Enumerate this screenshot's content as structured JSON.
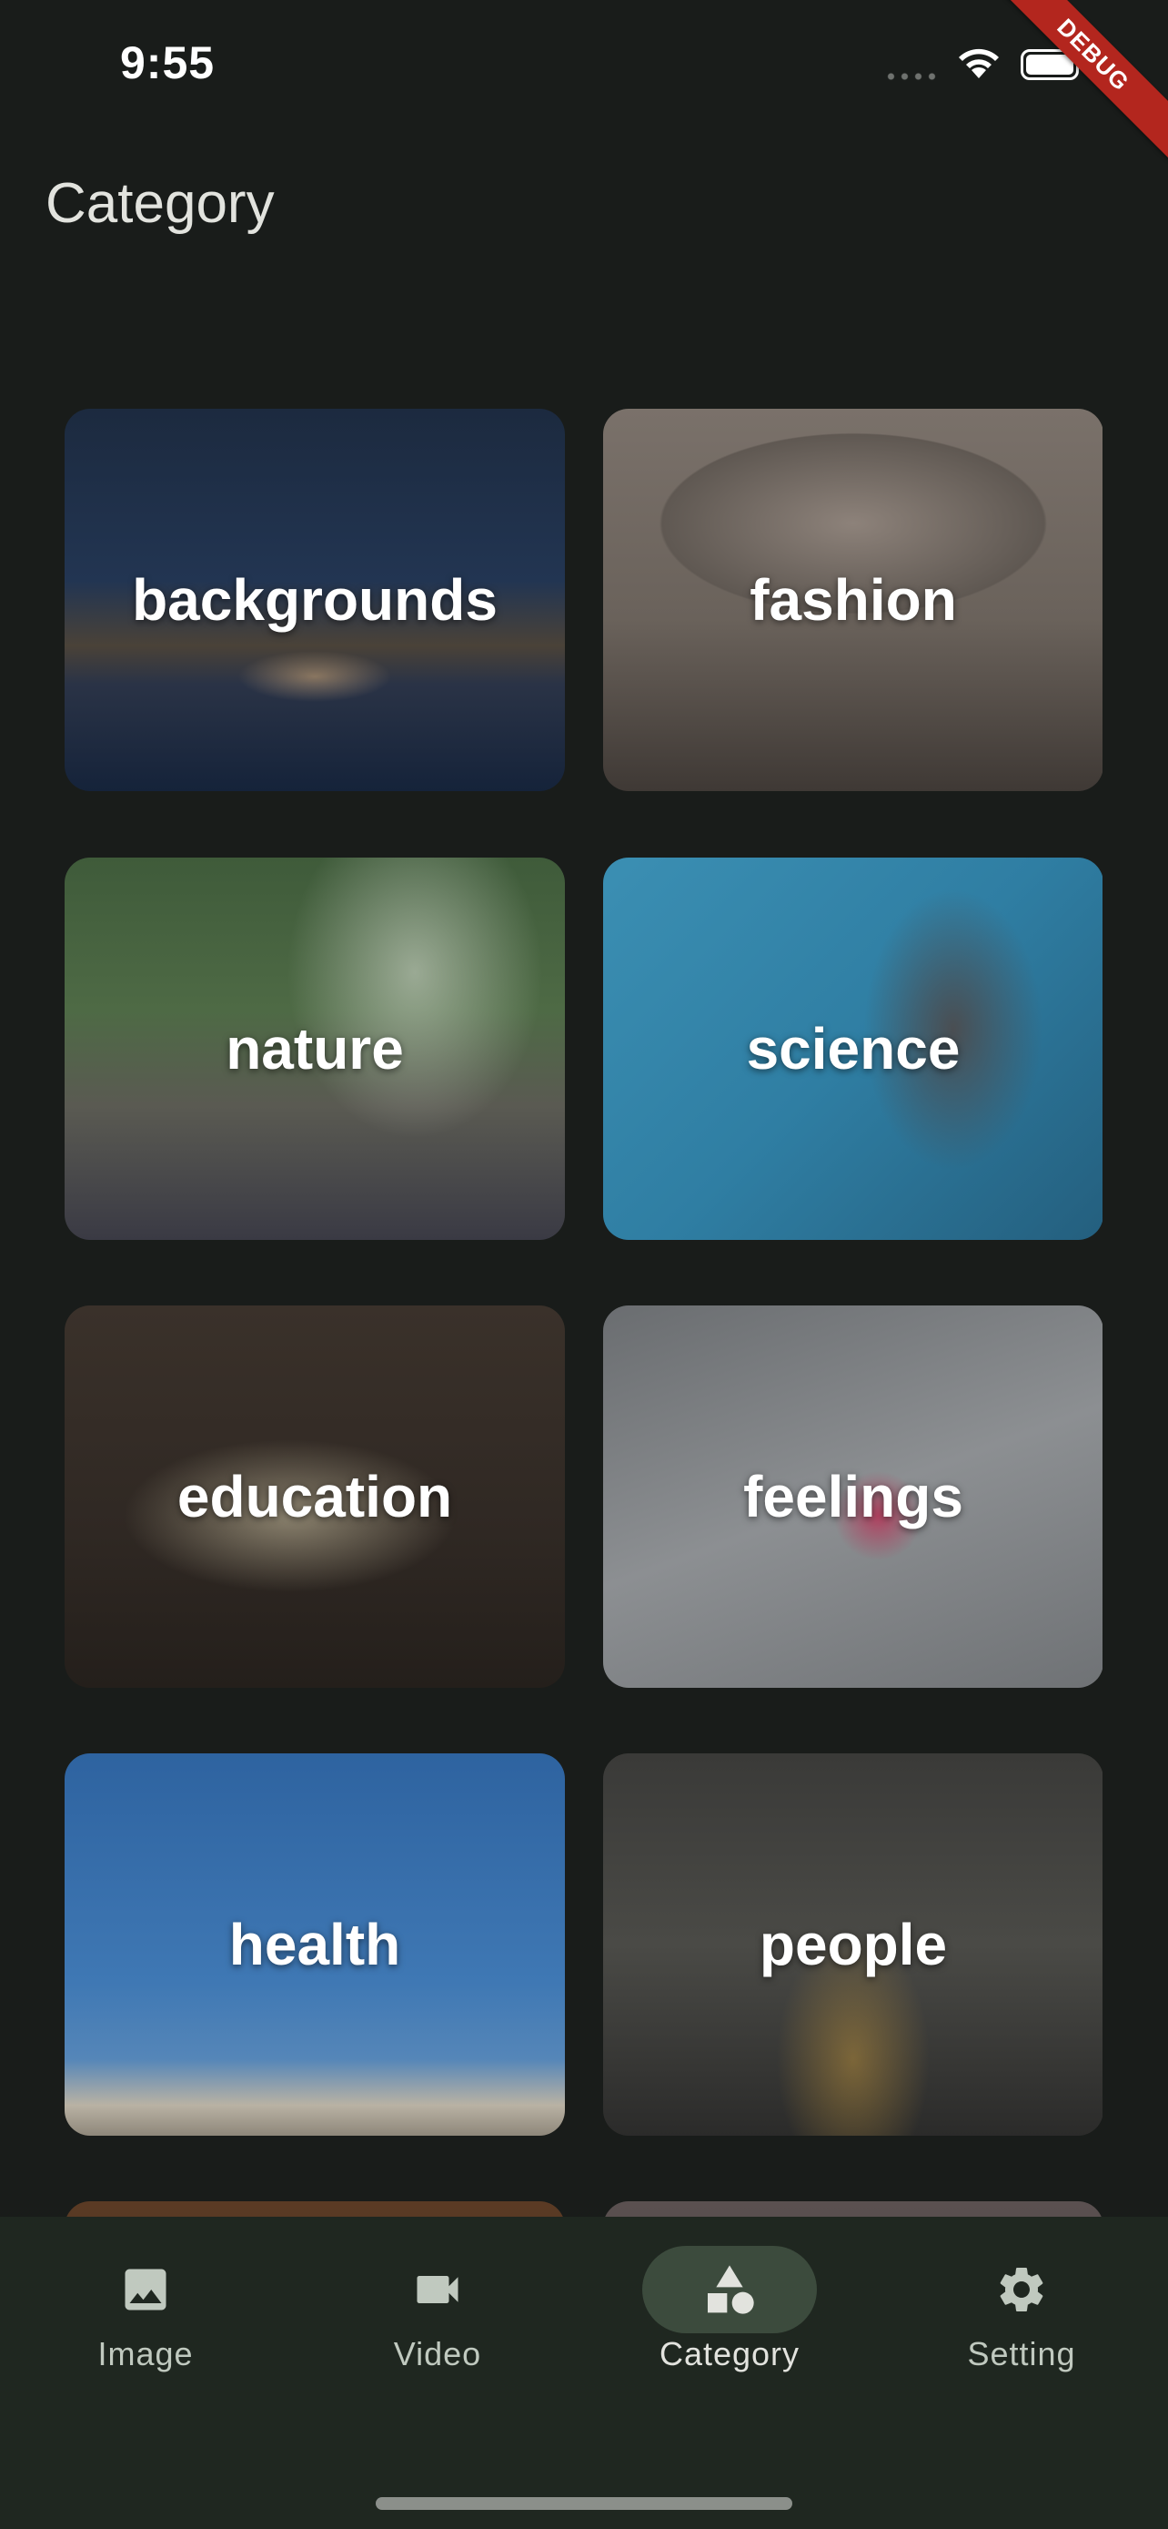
{
  "status_bar": {
    "time": "9:55"
  },
  "debug_banner": "DEBUG",
  "page": {
    "title": "Category"
  },
  "categories": [
    {
      "label": "backgrounds"
    },
    {
      "label": "fashion"
    },
    {
      "label": "nature"
    },
    {
      "label": "science"
    },
    {
      "label": "education"
    },
    {
      "label": "feelings"
    },
    {
      "label": "health"
    },
    {
      "label": "people"
    }
  ],
  "bottom_nav": {
    "items": [
      {
        "label": "Image",
        "icon": "image-icon"
      },
      {
        "label": "Video",
        "icon": "videocam-icon"
      },
      {
        "label": "Category",
        "icon": "category-icon",
        "active": true
      },
      {
        "label": "Setting",
        "icon": "gear-icon"
      }
    ]
  },
  "colors": {
    "background": "#191c1a",
    "nav_background": "#1f2720",
    "active_indicator": "#3c4b3d",
    "debug_banner": "#b3261e"
  }
}
